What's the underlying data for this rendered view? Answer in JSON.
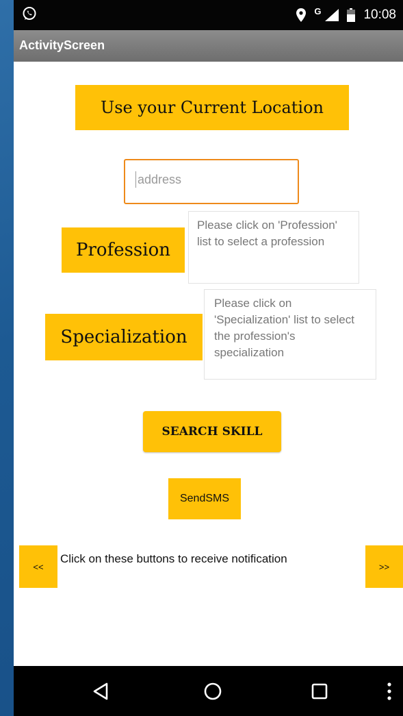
{
  "status_bar": {
    "time": "10:08",
    "network_label": "G",
    "icons": [
      "whatsapp-icon",
      "location-pin-icon",
      "signal-icon",
      "battery-icon"
    ]
  },
  "app_bar": {
    "title": "ActivityScreen"
  },
  "location_button": {
    "label": "Use your Current Location"
  },
  "address_input": {
    "value": "",
    "placeholder": "address"
  },
  "profession": {
    "button_label": "Profession",
    "hint": "Please click on 'Profession' list to select a profession"
  },
  "specialization": {
    "button_label": "Specialization",
    "hint": "Please click on 'Specialization' list to select the profession's specialization"
  },
  "search_button": {
    "label": "SEARCH SKILL"
  },
  "sms_button": {
    "label": "SendSMS"
  },
  "notification": {
    "prev_label": "<<",
    "text": "Click on these buttons to receive notification",
    "next_label": ">>"
  },
  "nav_bar": {
    "icons": [
      "back-icon",
      "home-icon",
      "recents-icon",
      "overflow-menu-icon"
    ]
  },
  "colors": {
    "accent": "#ffc107",
    "input_border": "#ee8a1a",
    "app_bar": "#7a7a7a"
  }
}
